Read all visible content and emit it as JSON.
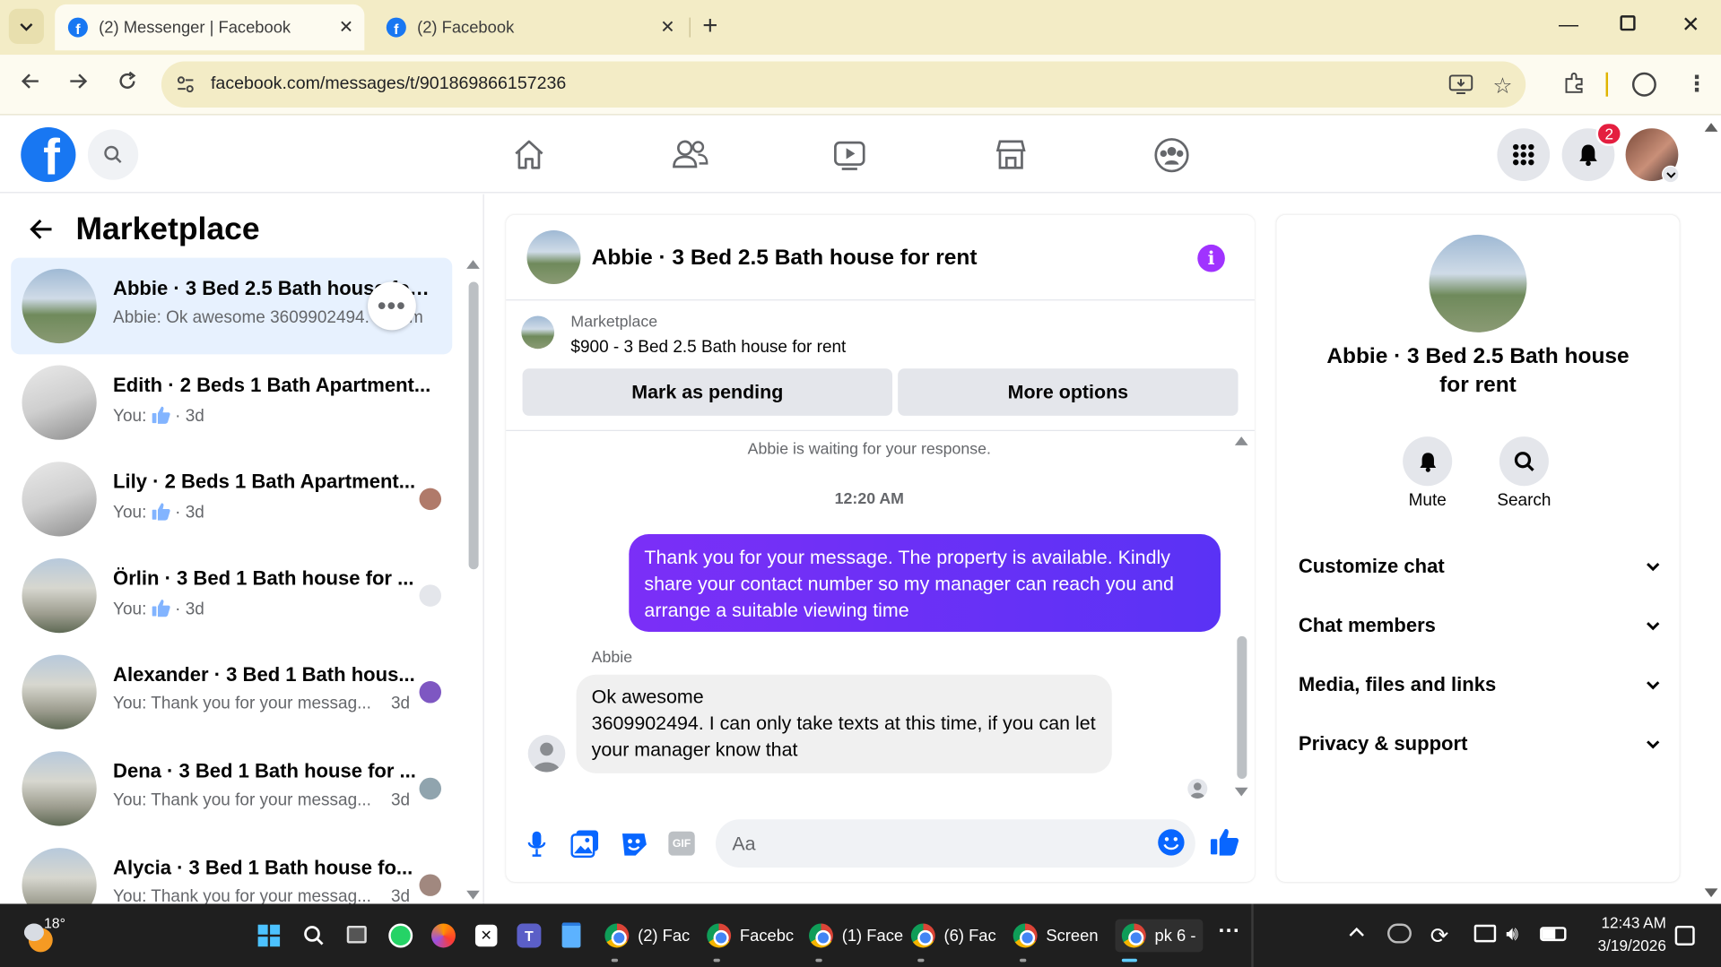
{
  "browser": {
    "tabs": [
      {
        "title": "(2) Messenger | Facebook",
        "active": true
      },
      {
        "title": "(2) Facebook",
        "active": false
      }
    ],
    "url": "facebook.com/messages/t/901869866157236",
    "new_tab": "+"
  },
  "facebook": {
    "notification_count": "2"
  },
  "sidebar": {
    "title": "Marketplace",
    "threads": [
      {
        "name": "Abbie · 3 Bed 2.5 Bath house for rent",
        "preview": "Abbie: Ok awesome 3609902494. I... · 1m",
        "preview_left": "Abbie: Ok awesome 3609902494.",
        "preview_right": "m",
        "time": "",
        "thumb": "house",
        "active": true
      },
      {
        "name": "Edith · 2 Beds 1 Bath Apartment...",
        "preview": "You:",
        "time": "· 3d",
        "thumb": "apartment",
        "like": true
      },
      {
        "name": "Lily · 2 Beds 1 Bath Apartment...",
        "preview": "You:",
        "time": "· 3d",
        "thumb": "apartment",
        "like": true
      },
      {
        "name": "Örlin · 3 Bed 1 Bath house for ...",
        "preview": "You:",
        "time": "· 3d",
        "thumb": "building",
        "like": true
      },
      {
        "name": "Alexander · 3 Bed 1 Bath hous...",
        "preview": "You: Thank you for your messag...",
        "time": "3d",
        "thumb": "building"
      },
      {
        "name": "Dena · 3 Bed 1 Bath house for ...",
        "preview": "You: Thank you for your messag...",
        "time": "3d",
        "thumb": "building"
      },
      {
        "name": "Alycia · 3 Bed 1 Bath house fo...",
        "preview": "You: Thank you for your messag...",
        "time": "3d",
        "thumb": "building"
      }
    ]
  },
  "chat": {
    "title": "Abbie · 3 Bed 2.5 Bath house for rent",
    "listing": {
      "label": "Marketplace",
      "summary": "$900 - 3 Bed 2.5 Bath house for rent"
    },
    "buttons": {
      "pending": "Mark as pending",
      "more": "More options"
    },
    "waiting_notice": "Abbie is waiting for your response.",
    "timestamp": "12:20 AM",
    "outgoing_message": "Thank you for your message. The property is available. Kindly share your contact number so my manager can reach you and arrange a suitable viewing time",
    "sender_name": "Abbie",
    "incoming_message": "Ok awesome\n3609902494. I can only take texts at this time, if you can let your manager know that",
    "composer_placeholder": "Aa"
  },
  "details": {
    "title": "Abbie · 3 Bed 2.5 Bath house for rent",
    "actions": {
      "mute": "Mute",
      "search": "Search"
    },
    "sections": [
      "Customize chat",
      "Chat members",
      "Media, files and links",
      "Privacy & support"
    ]
  },
  "taskbar": {
    "weather": "18°",
    "apps": [
      "(2) Fac",
      "Facebc",
      "(1) Face",
      "(6) Fac",
      "Screen",
      "pk 6 -"
    ],
    "clock_time": "12:43 AM",
    "clock_date": "3/19/2026"
  },
  "colors": {
    "fb_blue": "#1877f2",
    "outgoing_bubble": "#6a2ff2",
    "accent_purple": "#a033ff",
    "tab_strip": "#f3ecc6"
  }
}
